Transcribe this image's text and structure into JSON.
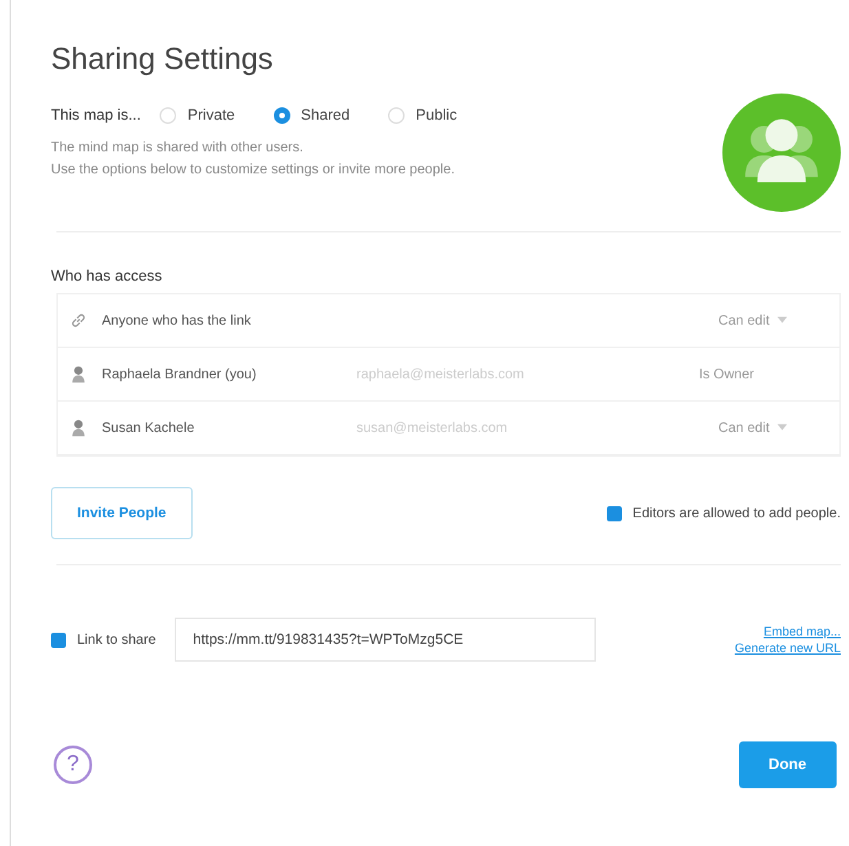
{
  "dialog": {
    "title": "Sharing Settings"
  },
  "visibility": {
    "label": "This map is...",
    "options": [
      {
        "label": "Private",
        "selected": false
      },
      {
        "label": "Shared",
        "selected": true
      },
      {
        "label": "Public",
        "selected": false
      }
    ]
  },
  "description": [
    "The mind map is shared with other users.",
    "Use the options below to customize settings or invite more people."
  ],
  "access": {
    "heading": "Who has access",
    "rows": [
      {
        "kind": "link",
        "name": "Anyone who has the link",
        "permission": "Can edit",
        "dropdown": true
      },
      {
        "kind": "person",
        "name": "Raphaela Brandner (you)",
        "email": "raphaela@meisterlabs.com",
        "permission": "Is Owner",
        "dropdown": false
      },
      {
        "kind": "person",
        "name": "Susan Kachele",
        "email": "susan@meisterlabs.com",
        "permission": "Can edit",
        "dropdown": true
      }
    ]
  },
  "invite_button": "Invite People",
  "editors_option": {
    "label": "Editors are allowed to add people.",
    "checked": true
  },
  "link_share": {
    "label": "Link to share",
    "checked": true,
    "value": "https://mm.tt/919831435?t=WPToMzg5CE",
    "links": [
      "Embed map...",
      "Generate new URL"
    ]
  },
  "done_button": "Done",
  "help": "?"
}
